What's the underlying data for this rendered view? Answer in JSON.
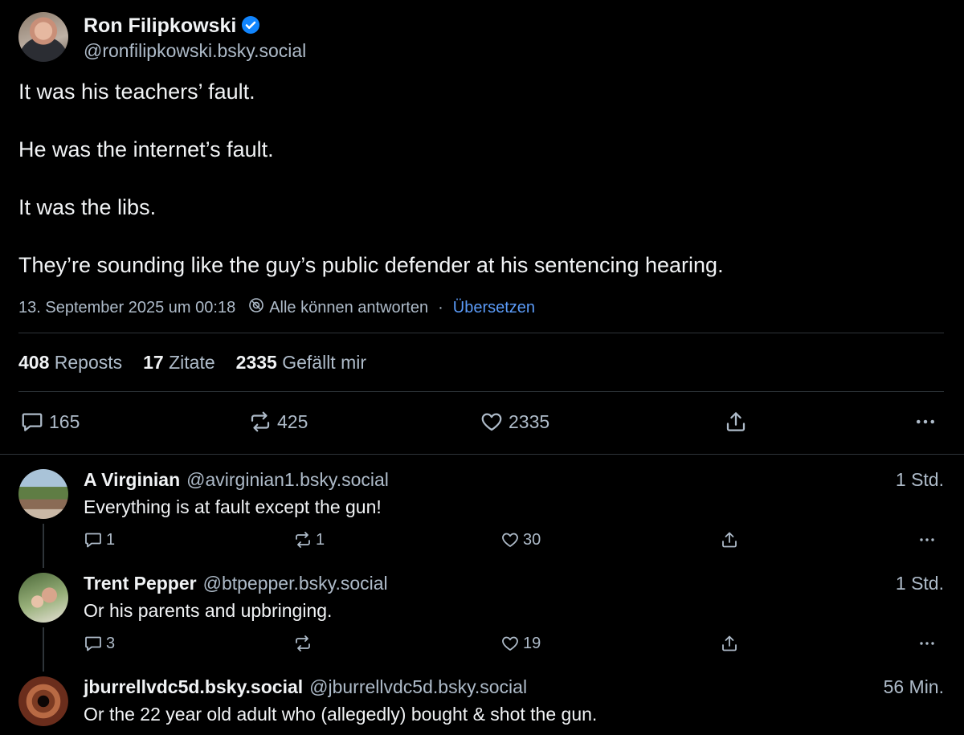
{
  "post": {
    "author_name": "Ron Filipkowski",
    "author_handle": "@ronfilipkowski.bsky.social",
    "lines": [
      "It was his teachers’ fault.",
      "He was the internet’s fault.",
      "It was the libs.",
      "They’re sounding like the guy’s public defender at his sentencing hearing."
    ],
    "timestamp": "13. September 2025 um 00:18",
    "reply_setting": "Alle können antworten",
    "separator": "·",
    "translate": "Übersetzen"
  },
  "stats": {
    "reposts_count": "408",
    "reposts_label": "Reposts",
    "quotes_count": "17",
    "quotes_label": "Zitate",
    "likes_count": "2335",
    "likes_label": "Gefällt mir"
  },
  "actions": {
    "replies": "165",
    "reposts": "425",
    "likes": "2335"
  },
  "replies": [
    {
      "name": "A Virginian",
      "handle": "@avirginian1.bsky.social",
      "time": "1 Std.",
      "text": "Everything is at fault except the gun!",
      "replies": "1",
      "reposts": "1",
      "likes": "30"
    },
    {
      "name": "Trent Pepper",
      "handle": "@btpepper.bsky.social",
      "time": "1 Std.",
      "text": "Or his parents and upbringing.",
      "replies": "3",
      "reposts": "",
      "likes": "19"
    },
    {
      "name": "jburrellvdc5d.bsky.social",
      "handle": "@jburrellvdc5d.bsky.social",
      "time": "56 Min.",
      "text": "Or the 22 year old adult who (allegedly) bought & shot the gun."
    }
  ],
  "colors": {
    "background": "#000000",
    "text": "#f1f3f5",
    "muted": "#aebbc9",
    "link": "#5b9bf8",
    "verified": "#1185fe"
  }
}
